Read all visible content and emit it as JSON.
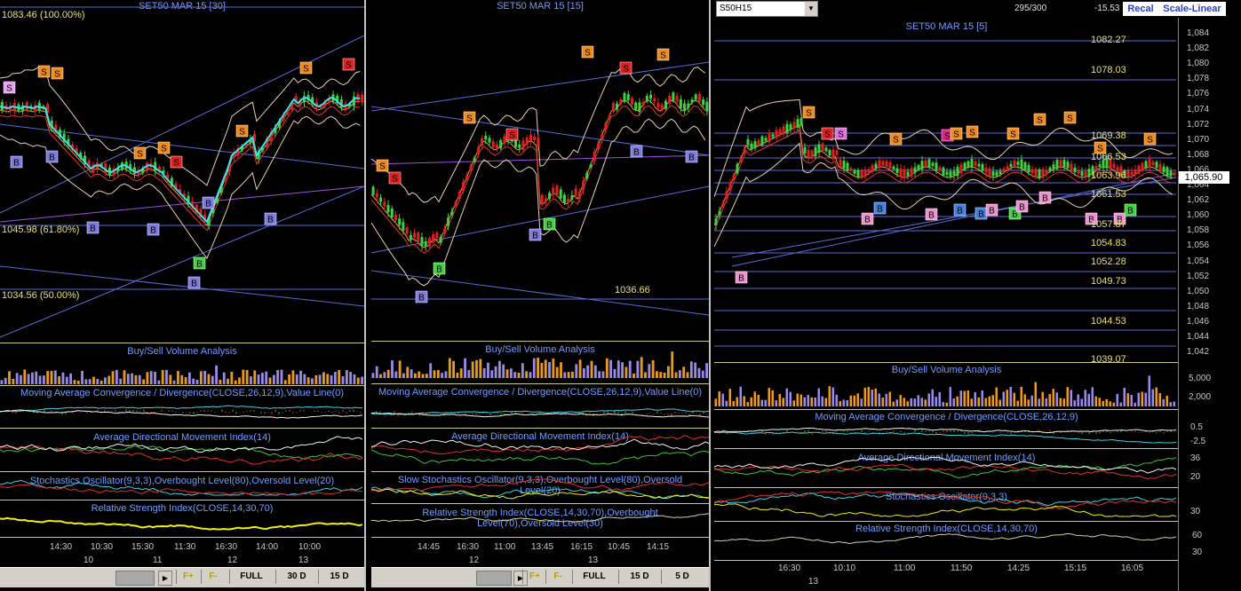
{
  "panels": [
    {
      "title": "SET50 MAR 15  [30]",
      "levels": [
        "1083.46 (100.00%)",
        "1045.98 (61.80%)",
        "1034.56 (50.00%)"
      ],
      "indicators": [
        "Buy/Sell Volume Analysis",
        "Moving Average Convergence / Divergence(CLOSE,26,12,9),Value Line(0)",
        "Average Directional Movement Index(14)",
        "Stochastics Oscillator(9,3,3),Overbought Level(80),Oversold Level(20)",
        "Relative Strength Index(CLOSE,14,30,70)"
      ],
      "times": [
        "14:30",
        "10:30",
        "15:30",
        "11:30",
        "16:30",
        "14:00",
        "10:00"
      ],
      "dates": [
        "10",
        "11",
        "12",
        "13"
      ],
      "toolbar": [
        "F+",
        "F-",
        "FULL",
        "30 D",
        "15 D"
      ]
    },
    {
      "title": "SET50 MAR 15  [15]",
      "levels": [
        "1036.66"
      ],
      "indicators": [
        "Buy/Sell Volume Analysis",
        "Moving Average Convergence / Divergence(CLOSE,26,12,9),Value Line(0)",
        "Average Directional Movement Index(14)",
        "Slow Stochastics Oscillator(9,3,3),Overbought Level(80),Oversold Level(20)",
        "Relative Strength Index(CLOSE,14,30,70),Overbought Level(70),Oversold Level(30)"
      ],
      "times": [
        "14:45",
        "16:30",
        "11:00",
        "13:45",
        "16:15",
        "10:45",
        "14:15"
      ],
      "dates": [
        "12",
        "13"
      ],
      "toolbar": [
        "F+",
        "F-",
        "FULL",
        "15 D",
        "5 D"
      ]
    },
    {
      "title": "SET50 MAR 15  [5]",
      "symbol": "S50H15",
      "counter": "295/300",
      "change": "-15.53",
      "recalc": "Recal",
      "scale": "Scale-Linear",
      "last_price": "1,065.90",
      "levels": [
        "1082.27",
        "1078.03",
        "1069.38",
        "1066.53",
        "1063.96",
        "1061.53",
        "1057.87",
        "1054.83",
        "1052.28",
        "1049.73",
        "1044.53",
        "1039.07"
      ],
      "axis": [
        "1,084",
        "1,082",
        "1,080",
        "1,078",
        "1,076",
        "1,074",
        "1,072",
        "1,070",
        "1,068",
        "1,066",
        "1,064",
        "1,062",
        "1,060",
        "1,058",
        "1,056",
        "1,054",
        "1,052",
        "1,050",
        "1,048",
        "1,046",
        "1,044",
        "1,042"
      ],
      "vol_axis": [
        "5,000",
        "2,000"
      ],
      "macd_axis": [
        "0.5",
        "-2.5"
      ],
      "adx_axis": [
        "36",
        "20"
      ],
      "stoch_axis": [
        "30"
      ],
      "rsi_axis": [
        "60",
        "30"
      ],
      "indicators": [
        "Buy/Sell Volume Analysis",
        "Moving Average Convergence / Divergence(CLOSE,26,12,9)",
        "Average Directional Movement Index(14)",
        "Stochastics Oscillator(9,3,3)",
        "Relative Strength Index(CLOSE,14,30,70)"
      ],
      "times": [
        "16:30",
        "10:10",
        "11:00",
        "11:50",
        "14:25",
        "15:15",
        "16:05"
      ],
      "dates": [
        "13"
      ]
    }
  ],
  "signals": {
    "sell": "S",
    "buy": "B"
  },
  "colors": {
    "up": "#3fd23f",
    "down": "#e02020",
    "ma_fast": "#40e0f0",
    "vol_buy": "#e89a1c",
    "vol_sell": "#9a8ae8",
    "rsi": "#f0f000"
  }
}
